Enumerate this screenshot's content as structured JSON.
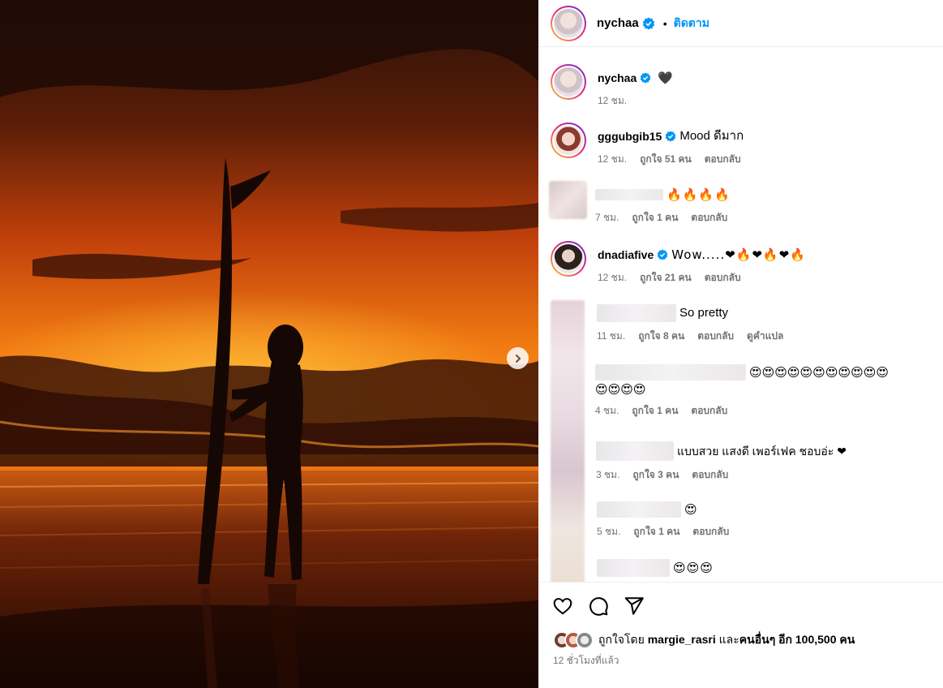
{
  "header": {
    "username": "nychaa",
    "separator": "•",
    "follow_label": "ติดตาม"
  },
  "caption": {
    "username": "nychaa",
    "text": "🖤",
    "time": "12 ชม."
  },
  "comments": [
    {
      "username": "gggubgib15",
      "verified": true,
      "text": "Mood ดีมาก",
      "time": "12 ชม.",
      "likes": "ถูกใจ 51 คน",
      "reply": "ตอบกลับ"
    },
    {
      "username": "",
      "verified": false,
      "text": "🔥🔥🔥🔥",
      "time": "7 ชม.",
      "likes": "ถูกใจ 1 คน",
      "reply": "ตอบกลับ"
    },
    {
      "username": "dnadiafive",
      "verified": true,
      "text": "Wow.....❤🔥❤🔥❤🔥",
      "time": "12 ชม.",
      "likes": "ถูกใจ 21 คน",
      "reply": "ตอบกลับ"
    },
    {
      "username": "",
      "verified": false,
      "text": "So pretty",
      "time": "11 ชม.",
      "likes": "ถูกใจ 8 คน",
      "reply": "ตอบกลับ",
      "translate": "ดูคำแปล"
    },
    {
      "username": "",
      "verified": false,
      "text": "😍😍😍😍😍😍😍😍😍😍😍",
      "text2": "😍😍😍😍",
      "time": "4 ชม.",
      "likes": "ถูกใจ 1 คน",
      "reply": "ตอบกลับ"
    },
    {
      "username": "",
      "verified": false,
      "text": "แบบสวย แสงดี เพอร์เฟค ชอบอ่ะ ❤",
      "time": "3 ชม.",
      "likes": "ถูกใจ 3 คน",
      "reply": "ตอบกลับ"
    },
    {
      "username": "",
      "verified": false,
      "text": "😍",
      "time": "5 ชม.",
      "likes": "ถูกใจ 1 คน",
      "reply": "ตอบกลับ"
    },
    {
      "username": "",
      "verified": false,
      "text": "😍😍😍",
      "time": "",
      "likes": "",
      "reply": ""
    }
  ],
  "footer": {
    "liked_prefix": "ถูกใจโดย",
    "liked_user": "margie_rasri",
    "liked_and": "และ",
    "liked_others": "คนอื่นๆ อีก 100,500 คน",
    "time_ago": "12 ชั่วโมงที่แล้ว"
  },
  "icons": [
    "heart-icon",
    "comment-icon",
    "share-icon",
    "verified-icon",
    "chevron-right-icon"
  ],
  "colors": {
    "link": "#0095f6",
    "verified": "#0095f6",
    "muted": "#737373",
    "heart": "#e0182d"
  }
}
